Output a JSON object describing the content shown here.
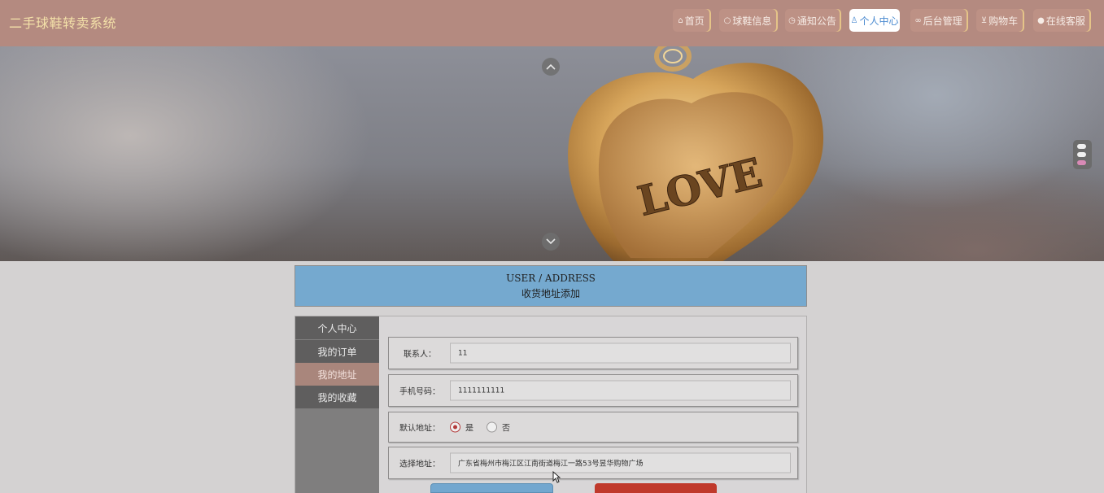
{
  "app": {
    "title": "二手球鞋转卖系统"
  },
  "nav": [
    {
      "label": "首页",
      "icon": "home-icon",
      "glyph": "⌂"
    },
    {
      "label": "球鞋信息",
      "icon": "chat-icon",
      "glyph": "○"
    },
    {
      "label": "通知公告",
      "icon": "clock-icon",
      "glyph": "◷"
    },
    {
      "label": "个人中心",
      "icon": "user-icon",
      "glyph": "♙",
      "active": true
    },
    {
      "label": "后台管理",
      "icon": "link-icon",
      "glyph": "∞"
    },
    {
      "label": "购物车",
      "icon": "cart-icon",
      "glyph": "⊻"
    },
    {
      "label": "在线客服",
      "icon": "support-icon",
      "glyph": "●"
    }
  ],
  "banner": {
    "pendant_text": "LOVE"
  },
  "page": {
    "title_en": "USER / ADDRESS",
    "title_zh": "收货地址添加"
  },
  "menu": [
    {
      "label": "个人中心"
    },
    {
      "label": "我的订单"
    },
    {
      "label": "我的地址",
      "active": true
    },
    {
      "label": "我的收藏"
    }
  ],
  "form": {
    "contact": {
      "label": "联系人：",
      "value": "11"
    },
    "phone": {
      "label": "手机号码：",
      "value": "1111111111"
    },
    "default_address": {
      "label": "默认地址：",
      "option_yes": "是",
      "option_no": "否",
      "selected": "是"
    },
    "address": {
      "label": "选择地址：",
      "value": "广东省梅州市梅江区江南街道梅江一路53号昱华购物广场"
    }
  },
  "colors": {
    "header_bg": "#b48a80",
    "logo": "#f3e0a8",
    "title_box": "#75a9cf",
    "menu_active": "#a9867c",
    "submit_button": "#73a7cf",
    "reset_button": "#c0392b"
  }
}
